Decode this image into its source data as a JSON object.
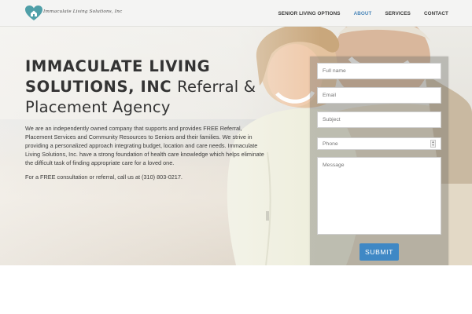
{
  "header": {
    "logo_text": "Immaculate Living Solutions, Inc",
    "nav": [
      {
        "label": "SENIOR LIVING OPTIONS",
        "active": false
      },
      {
        "label": "ABOUT",
        "active": true
      },
      {
        "label": "SERVICES",
        "active": false
      },
      {
        "label": "CONTACT",
        "active": false
      }
    ],
    "active_color": "#4a86b9",
    "logo_icon": "heart-house-icon",
    "logo_color": "#4f9fa8"
  },
  "hero": {
    "title_bold": "IMMACULATE LIVING SOLUTIONS, INC",
    "title_light": "Referral & Placement Agency",
    "description": "We are an independently owned company that supports and provides FREE Referral, Placement Services and Community Resources to Seniors and their families. We strive in providing a personalized approach integrating budget, location and care needs. Immaculate Living Solutions, Inc. have a strong foundation of health care knowledge which helps eliminate the difficult task of finding appropriate care for a loved one.",
    "cta": "For a FREE consultation or referral, call us at (310) 803-0217."
  },
  "form": {
    "name_placeholder": "Full name",
    "email_placeholder": "Email",
    "subject_placeholder": "Subject",
    "phone_placeholder": "Phone",
    "message_placeholder": "Message",
    "submit_label": "SUBMIT",
    "submit_color": "#3f88c5"
  }
}
